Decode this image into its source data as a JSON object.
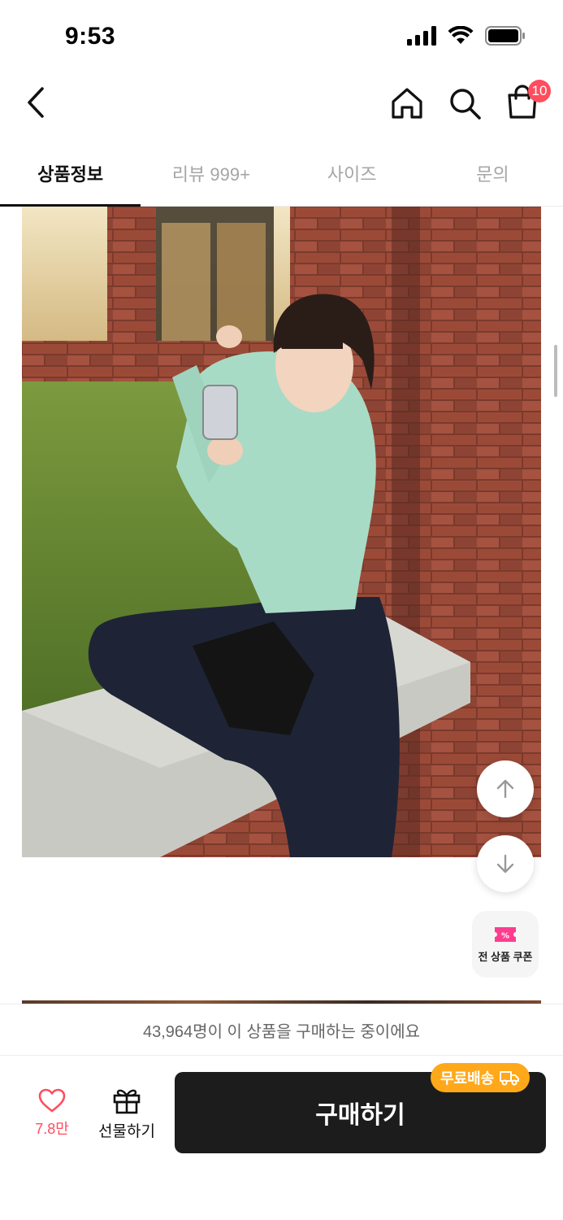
{
  "status_bar": {
    "time": "9:53",
    "icons": [
      "cellular-signal-icon",
      "wifi-icon",
      "battery-icon"
    ]
  },
  "header": {
    "back_icon": "chevron-left-icon",
    "home_icon": "home-icon",
    "search_icon": "search-icon",
    "cart_icon": "shopping-bag-icon",
    "cart_count": "10"
  },
  "tabs": [
    {
      "label": "상품정보",
      "active": true
    },
    {
      "label": "리뷰 999+",
      "active": false
    },
    {
      "label": "사이즈",
      "active": false
    },
    {
      "label": "문의",
      "active": false
    }
  ],
  "floating": {
    "scroll_up_icon": "arrow-up-icon",
    "scroll_down_icon": "arrow-down-icon",
    "coupon_icon": "coupon-ticket-icon",
    "coupon_label": "전 상품 쿠폰"
  },
  "buyers_text": "43,964명이 이 상품을 구매하는 중이에요",
  "bottom": {
    "like_count": "7.8만",
    "gift_label": "선물하기",
    "buy_label": "구매하기",
    "shipping_badge": "무료배송"
  },
  "colors": {
    "accent_red": "#ff4d5e",
    "buy_button": "#1c1c1c",
    "shipping_badge": "#ffa81a",
    "coupon_pink": "#ff3d8f"
  }
}
